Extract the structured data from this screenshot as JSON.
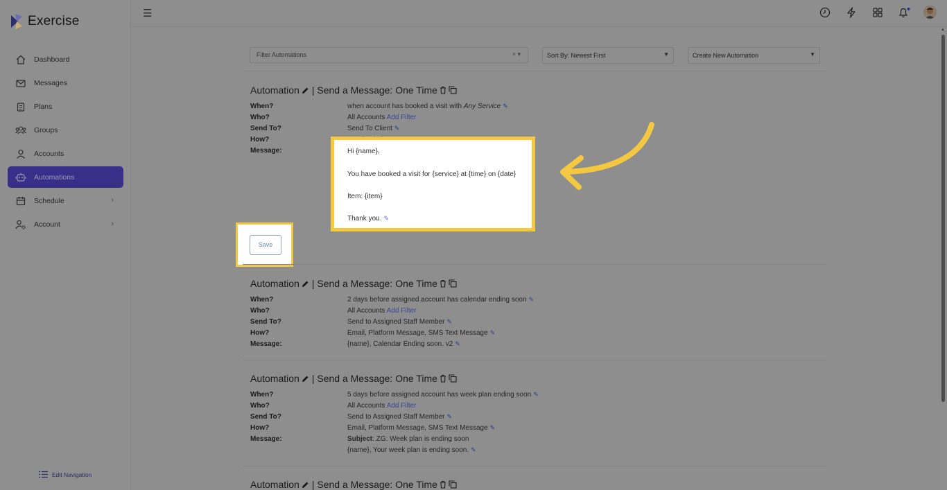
{
  "app": {
    "title": "Exercise"
  },
  "sidebar": {
    "items": [
      {
        "label": "Dashboard",
        "icon": "home-icon"
      },
      {
        "label": "Messages",
        "icon": "mail-icon"
      },
      {
        "label": "Plans",
        "icon": "clipboard-icon"
      },
      {
        "label": "Groups",
        "icon": "users-icon"
      },
      {
        "label": "Accounts",
        "icon": "user-icon"
      },
      {
        "label": "Automations",
        "icon": "robot-icon",
        "active": true
      },
      {
        "label": "Schedule",
        "icon": "calendar-icon",
        "has_submenu": true
      },
      {
        "label": "Account",
        "icon": "user-gear-icon",
        "has_submenu": true
      }
    ],
    "edit_navigation": "Edit Navigation"
  },
  "topbar": {
    "icons": [
      "clock-icon",
      "bolt-icon",
      "grid-icon",
      "bell-icon",
      "avatar"
    ]
  },
  "toolbar": {
    "filter_placeholder": "Filter Automations",
    "filter_controls": "× ▾",
    "sort_label": "Sort By: Newest First",
    "create_label": "Create New Automation"
  },
  "labels": {
    "when": "When?",
    "who": "Who?",
    "send_to": "Send To?",
    "how": "How?",
    "message": "Message:"
  },
  "automations": [
    {
      "title_prefix": "Automation",
      "title": "| Send a Message: One Time",
      "when_text": "when account has booked a visit with ",
      "when_em": "Any Service",
      "who": "All Accounts",
      "add_filter": "Add Filter",
      "send_to": "Send To Client",
      "how": "Email, Platform Message, SMS Text Message",
      "message_lines": [
        "Hi {name},",
        "You have booked a visit for {service} at {time} on {date}",
        "Item: {item}",
        "Thank you."
      ],
      "save_label": "Save"
    },
    {
      "title_prefix": "Automation",
      "title": "| Send a Message: One Time",
      "when": "2 days before assigned account has calendar ending soon",
      "who": "All Accounts",
      "add_filter": "Add Filter",
      "send_to": "Send to Assigned Staff Member",
      "how": "Email, Platform Message, SMS Text Message",
      "message": "{name}, Calendar Ending soon. v2"
    },
    {
      "title_prefix": "Automation",
      "title": "| Send a Message: One Time",
      "when": "5 days before assigned account has week plan ending soon",
      "who": "All Accounts",
      "add_filter": "Add Filter",
      "send_to": "Send to Assigned Staff Member",
      "how": "Email, Platform Message, SMS Text Message",
      "message_subject_label": "Subject",
      "message_subject": ": ZG: Week plan is ending soon",
      "message": "{name}, Your week plan is ending soon."
    },
    {
      "title_prefix": "Automation",
      "title": "| Send a Message: One Time"
    }
  ],
  "colors": {
    "highlight": "#f5c842",
    "active_nav": "#382f88",
    "link": "#384894",
    "overlay_bg": "#8e8e8e"
  }
}
